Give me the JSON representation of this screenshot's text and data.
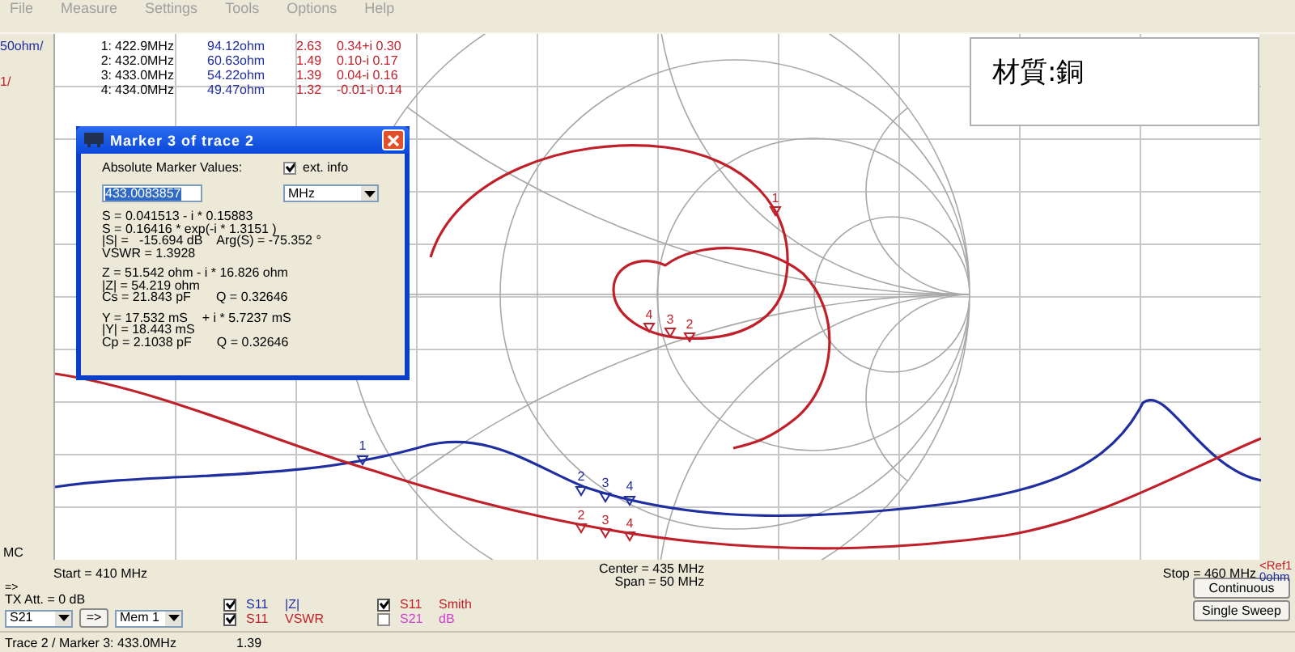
{
  "menu": [
    "File",
    "Measure",
    "Settings",
    "Tools",
    "Options",
    "Help"
  ],
  "plot": {
    "scale_labels": [
      {
        "text": "50ohm/",
        "color": "#1f2fa0"
      },
      {
        "text": "1/",
        "color": "#c0202a"
      }
    ],
    "mode_label": "MC",
    "marker_table": [
      {
        "index": "1:",
        "frequency": "422.9MHz",
        "impedance": "94.12ohm",
        "vswr": "2.63",
        "reflection": "0.34+i 0.30"
      },
      {
        "index": "2:",
        "frequency": "432.0MHz",
        "impedance": "60.63ohm",
        "vswr": "1.49",
        "reflection": "0.10-i 0.17"
      },
      {
        "index": "3:",
        "frequency": "433.0MHz",
        "impedance": "54.22ohm",
        "vswr": "1.39",
        "reflection": "0.04-i 0.16"
      },
      {
        "index": "4:",
        "frequency": "434.0MHz",
        "impedance": "49.47ohm",
        "vswr": "1.32",
        "reflection": "-0.01-i 0.14"
      }
    ],
    "smith_markers": [
      "1",
      "4",
      "3",
      "2"
    ],
    "z_markers": [
      "1",
      "2",
      "3",
      "4"
    ],
    "vswr_markers": [
      "2",
      "3",
      "4"
    ],
    "start": "Start = 410 MHz",
    "center": "Center = 435 MHz",
    "span": "Span = 50 MHz",
    "stop": "Stop = 460 MHz",
    "ref_label": "<Ref1",
    "ref_value": "0ohm"
  },
  "note": {
    "text": "材質:銅"
  },
  "marker_dialog": {
    "title": "Marker 3 of trace 2",
    "values_label": "Absolute Marker Values:",
    "ext_info": {
      "label": "ext. info",
      "checked": true
    },
    "frequency_value": "433.0083857",
    "unit": "MHz",
    "groups": [
      [
        "S = 0.041513 - i * 0.15883",
        "S = 0.16416 * exp(-i * 1.3151 )",
        "|S| =   -15.694 dB    Arg(S) = -75.352 °",
        "VSWR = 1.3928"
      ],
      [
        "Z = 51.542 ohm - i * 16.826 ohm",
        "|Z| = 54.219 ohm",
        "Cs = 21.843 pF       Q = 0.32646"
      ],
      [
        "Y = 17.532 mS    + i * 5.7237 mS",
        "|Y| = 18.443 mS",
        "Cp = 2.1038 pF       Q = 0.32646"
      ]
    ]
  },
  "controls": {
    "arrow": "=>",
    "tx_att": "TX Att. = 0 dB",
    "trace_select": "S21",
    "copy_button": "=>",
    "memory_select": "Mem 1",
    "traces": [
      {
        "param": "S11",
        "quantity": "|Z|",
        "checked": true,
        "color": "#1f2fa0"
      },
      {
        "param": "S11",
        "quantity": "VSWR",
        "checked": true,
        "color": "#c0202a"
      },
      {
        "param": "S11",
        "quantity": "Smith",
        "checked": true,
        "color": "#c0202a"
      },
      {
        "param": "S21",
        "quantity": "dB",
        "checked": false,
        "color": "#d040d0"
      }
    ],
    "buttons": [
      "Continuous",
      "Single Sweep"
    ]
  },
  "status_bar": {
    "trace_marker": "Trace 2 / Marker 3: 433.0MHz",
    "value": "1.39"
  }
}
